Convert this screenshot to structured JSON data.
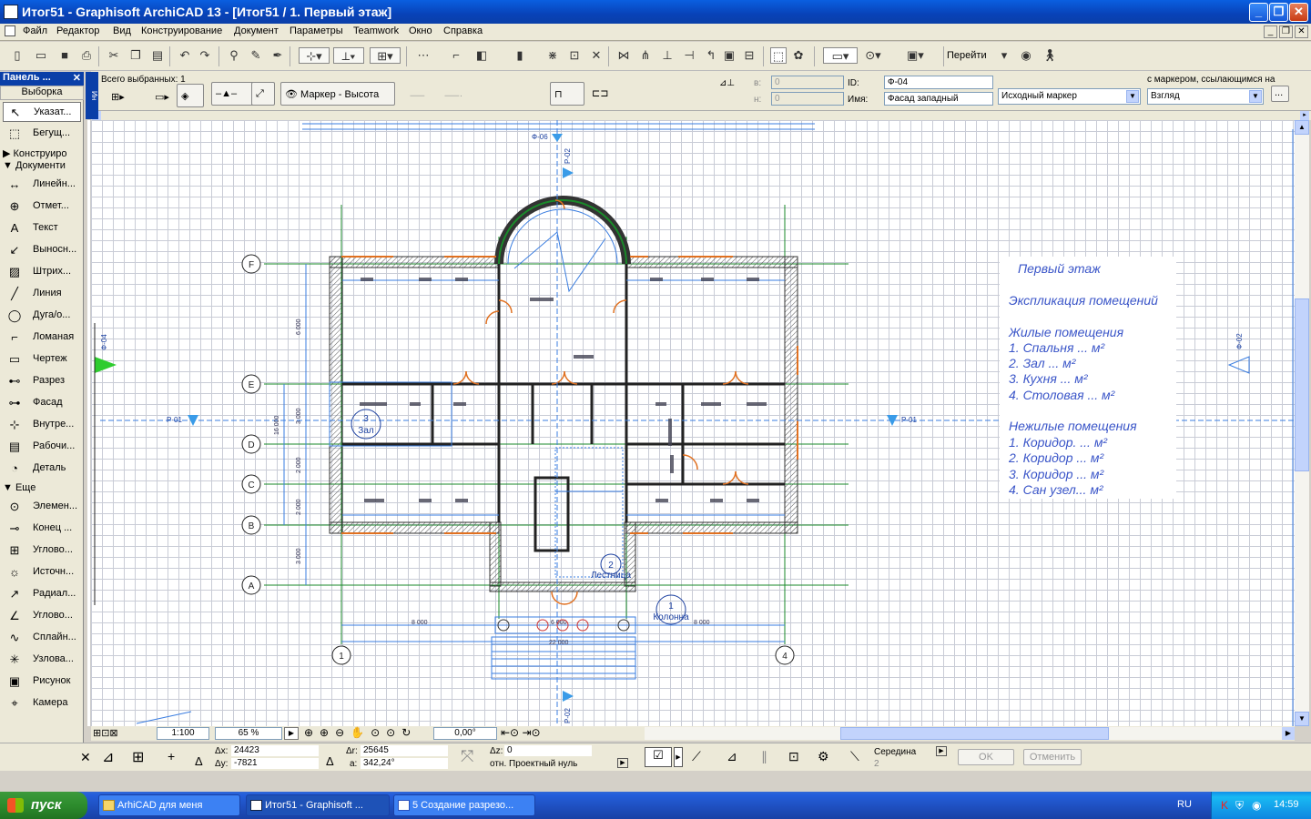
{
  "window": {
    "title": "Итог51 - Graphisoft ArchiCAD 13 - [Итог51 / 1. Первый этаж]"
  },
  "menu": [
    "Файл",
    "Редактор",
    "Вид",
    "Конструирование",
    "Документ",
    "Параметры",
    "Teamwork",
    "Окно",
    "Справка"
  ],
  "toolbar": {
    "goto_label": "Перейти"
  },
  "infobox": {
    "selected_count": "Всего выбранных: 1",
    "marker_button": "Маркер - Высота",
    "field_b_label": "в:",
    "field_b_value": "0",
    "field_h_label": "н:",
    "field_h_value": "0",
    "id_label": "ID:",
    "id_value": "Ф-04",
    "name_label": "Имя:",
    "name_value": "Фасад западный",
    "marker_select": "Исходный маркер",
    "ref_label": "с маркером, ссылающимся на",
    "ref_select": "Взгляд",
    "more_button": "..."
  },
  "panel": {
    "title": "Панель ...",
    "selection": "Выборка",
    "items_top": [
      {
        "icon": "arrow-pointer-icon",
        "label": "Указат..."
      },
      {
        "icon": "marquee-icon",
        "label": "Бегущ..."
      }
    ],
    "group_construct": "Конструиро",
    "group_document": "Документи",
    "items_doc": [
      {
        "icon": "linear-dimension-icon",
        "label": "Линейн..."
      },
      {
        "icon": "level-dimension-icon",
        "label": "Отмет..."
      },
      {
        "icon": "text-icon",
        "label": "Текст"
      },
      {
        "icon": "label-icon",
        "label": "Выносн..."
      },
      {
        "icon": "hatch-icon",
        "label": "Штрих..."
      },
      {
        "icon": "line-icon",
        "label": "Линия"
      },
      {
        "icon": "arc-icon",
        "label": "Дуга/о..."
      },
      {
        "icon": "polyline-icon",
        "label": "Ломаная"
      },
      {
        "icon": "drawing-icon",
        "label": "Чертеж"
      },
      {
        "icon": "section-icon",
        "label": "Разрез"
      },
      {
        "icon": "elevation-icon",
        "label": "Фасад"
      },
      {
        "icon": "interior-elevation-icon",
        "label": "Внутре..."
      },
      {
        "icon": "worksheet-icon",
        "label": "Рабочи..."
      },
      {
        "icon": "detail-icon",
        "label": "Деталь"
      }
    ],
    "group_more": "Еще",
    "items_more": [
      {
        "icon": "element-icon",
        "label": "Элемен..."
      },
      {
        "icon": "end-icon",
        "label": "Конец ..."
      },
      {
        "icon": "corner-icon",
        "label": "Углово..."
      },
      {
        "icon": "light-source-icon",
        "label": "Источн..."
      },
      {
        "icon": "radial-dimension-icon",
        "label": "Радиал..."
      },
      {
        "icon": "angle-dimension-icon",
        "label": "Углово..."
      },
      {
        "icon": "spline-icon",
        "label": "Сплайн..."
      },
      {
        "icon": "hotspot-icon",
        "label": "Узлова..."
      },
      {
        "icon": "picture-icon",
        "label": "Рисунок"
      },
      {
        "icon": "camera-icon",
        "label": "Камера"
      }
    ]
  },
  "plan": {
    "grid_rows": [
      "F",
      "E",
      "D",
      "C",
      "B",
      "A"
    ],
    "grid_cols": [
      "1",
      "4"
    ],
    "markers": {
      "top_elev": "Ф-06",
      "top_sect": "Р-02",
      "bottom_sect": "Р-02",
      "left_sect": "Р-01",
      "right_sect": "Р-01",
      "left_elev": "Ф-04",
      "right_elev": "Ф-02"
    },
    "dims_v": [
      "6 000",
      "3 000",
      "16 000",
      "2 000",
      "2 000",
      "3 000"
    ],
    "dims_h": [
      "8 000",
      "6 000",
      "8 000",
      "22 000"
    ],
    "rooms": [
      {
        "num": "3",
        "name": "Зал"
      },
      {
        "num": "2",
        "name": "Лестница"
      },
      {
        "num": "1",
        "name": "Колонна"
      }
    ]
  },
  "legend": {
    "title": "Первый этаж",
    "subtitle": "Экспликация помещений",
    "group1": "Жилые помещения",
    "items1": [
      "1. Спальня      ... м²",
      "2. Зал             ... м²",
      "3. Кухня          ... м²",
      "4. Столовая     ... м²"
    ],
    "group2": "Нежилые помещения",
    "items2": [
      "1. Коридор.      ... м²",
      "2. Коридор       ... м²",
      "3. Коридор       ... м²",
      "4. Сан узел... м²"
    ]
  },
  "viewbar": {
    "scale": "1:100",
    "zoom": "65 %",
    "angle": "0,00°"
  },
  "coords": {
    "dx_label": "Δx:",
    "dx": "24423",
    "dy_label": "Δy:",
    "dy": "-7821",
    "dr_label": "Δr:",
    "dr": "25645",
    "da_label": "a:",
    "da": "342,24°",
    "dz_label": "Δz:",
    "dz": "0",
    "ref": "отн. Проектный нуль",
    "snap": "Середина",
    "snap_num": "2",
    "ok": "OK",
    "cancel": "Отменить"
  },
  "taskbar": {
    "start": "пуск",
    "tasks": [
      "ArhiCAD для меня",
      "Итог51 - Graphisoft ...",
      "5 Создание разрезо..."
    ],
    "lang": "RU",
    "time": "14:59"
  },
  "colors": {
    "titlebar": "#0a3fa8",
    "plan_green": "#1a8a2a",
    "plan_blue": "#3a7de0",
    "door_orange": "#e07020",
    "legend_text": "#3a55c8"
  }
}
